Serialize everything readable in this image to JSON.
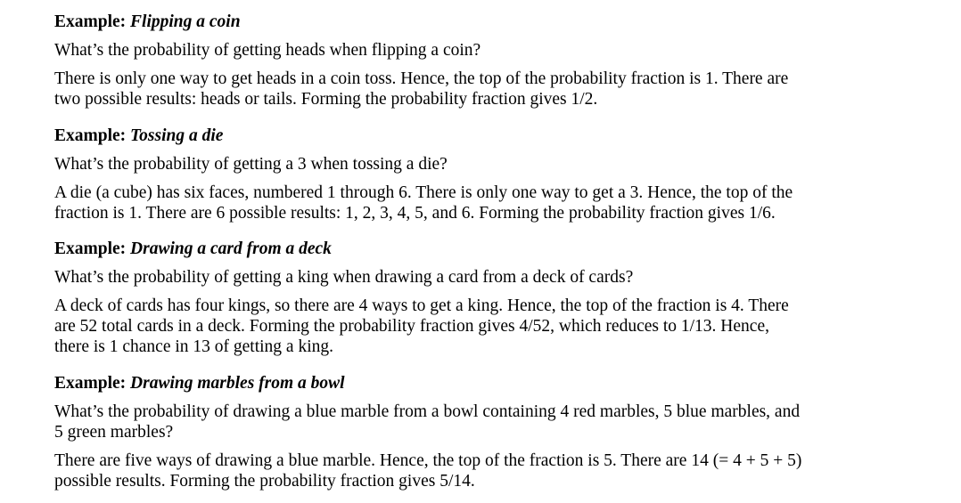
{
  "examples": [
    {
      "label": "Example: ",
      "title": "Flipping a coin",
      "question": "What’s the probability of getting heads when flipping a coin?",
      "lines": [
        "There is only one way to get heads in a coin toss.  Hence, the top of the probability fraction is 1.  There are",
        "two possible results: heads or tails.  Forming the probability fraction gives 1/2."
      ]
    },
    {
      "label": "Example: ",
      "title": "Tossing a die",
      "question": "What’s the probability of getting a 3 when tossing a die?",
      "lines": [
        "A die (a cube) has six faces, numbered 1 through 6.  There is only one way to get a 3.  Hence, the top of the",
        "fraction is 1.  There are 6 possible results: 1, 2, 3, 4, 5, and 6.  Forming the probability fraction gives 1/6."
      ]
    },
    {
      "label": "Example: ",
      "title": "Drawing a card from a deck",
      "question": "What’s the probability of getting a king when drawing a card from a deck of cards?",
      "lines": [
        "A deck of cards has four kings, so there are 4 ways to get a king.  Hence, the top of the fraction is 4.  There",
        "are 52 total cards in a deck.   Forming the probability fraction gives 4/52, which reduces to 1/13.   Hence,",
        "there is 1 chance in 13 of getting a king."
      ]
    },
    {
      "label": "Example: ",
      "title": "Drawing marbles from a bowl",
      "question_lines": [
        "What’s the probability of drawing a blue marble from a bowl containing 4 red marbles, 5 blue marbles, and",
        "5 green marbles?"
      ],
      "lines": [
        "There are five ways of drawing a blue marble. Hence, the top of the fraction is 5. There are 14 (= 4 + 5 + 5)",
        "possible results.  Forming the probability fraction gives 5/14."
      ]
    }
  ]
}
